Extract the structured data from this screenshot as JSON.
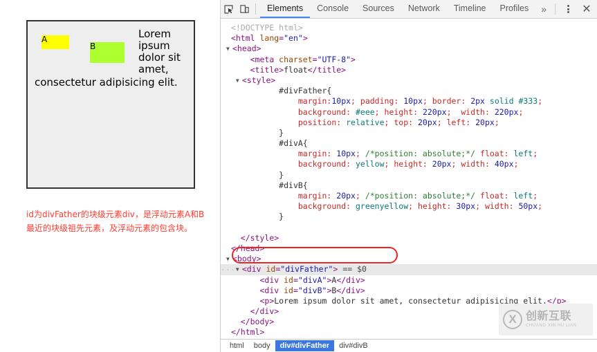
{
  "preview": {
    "box_a_label": "A",
    "box_b_label": "B",
    "paragraph": "Lorem ipsum dolor sit amet, consectetur adipisicing elit.",
    "caption": "id为divFather的块级元素div，是浮动元素A和B最近的块级祖先元素，及浮动元素的包含块。",
    "colors": {
      "father_background": "#eee",
      "father_border": "#333",
      "box_a_background": "yellow",
      "box_b_background": "greenyellow",
      "caption_color": "#ff3b30"
    }
  },
  "devtools": {
    "toolbar": {
      "inspect_icon": "inspect-element-icon",
      "device_icon": "device-toolbar-icon",
      "more_tabs_label": "»",
      "menu_icon": "kebab-menu-icon",
      "close_label": "✕"
    },
    "tabs": [
      {
        "label": "Elements",
        "active": true
      },
      {
        "label": "Console",
        "active": false
      },
      {
        "label": "Sources",
        "active": false
      },
      {
        "label": "Network",
        "active": false
      },
      {
        "label": "Timeline",
        "active": false
      },
      {
        "label": "Profiles",
        "active": false
      }
    ],
    "code_lines": [
      {
        "indent": 0,
        "tokens": [
          {
            "c": "tok-comment",
            "t": "<!DOCTYPE html>"
          }
        ]
      },
      {
        "indent": 0,
        "tokens": [
          {
            "c": "tok-punct",
            "t": "<html "
          },
          {
            "c": "tok-attr",
            "t": "lang"
          },
          {
            "c": "tok-punct",
            "t": "="
          },
          {
            "c": "tok-val",
            "t": "\"en\""
          },
          {
            "c": "tok-punct",
            "t": ">"
          }
        ]
      },
      {
        "indent": 0,
        "triangle": "▼",
        "tokens": [
          {
            "c": "tok-punct",
            "t": "<head>"
          }
        ]
      },
      {
        "indent": 2,
        "tokens": [
          {
            "c": "tok-punct",
            "t": "<meta "
          },
          {
            "c": "tok-attr",
            "t": "charset"
          },
          {
            "c": "tok-punct",
            "t": "="
          },
          {
            "c": "tok-val",
            "t": "\"UTF-8\""
          },
          {
            "c": "tok-punct",
            "t": ">"
          }
        ]
      },
      {
        "indent": 2,
        "tokens": [
          {
            "c": "tok-punct",
            "t": "<title>"
          },
          {
            "c": "tok-text",
            "t": "float"
          },
          {
            "c": "tok-punct",
            "t": "</title>"
          }
        ]
      },
      {
        "indent": 1,
        "triangle": "▼",
        "tokens": [
          {
            "c": "tok-punct",
            "t": "<style>"
          }
        ]
      },
      {
        "indent": 5,
        "tokens": [
          {
            "c": "tok-sel",
            "t": "#divFather{"
          }
        ]
      },
      {
        "indent": 7,
        "tokens": [
          {
            "c": "tok-prop",
            "t": "margin"
          },
          {
            "c": "tok-prop",
            "t": ":"
          },
          {
            "c": "tok-num",
            "t": "10px"
          },
          {
            "c": "tok-prop",
            "t": "; "
          },
          {
            "c": "tok-prop",
            "t": "padding"
          },
          {
            "c": "tok-prop",
            "t": ": "
          },
          {
            "c": "tok-num",
            "t": "10px"
          },
          {
            "c": "tok-prop",
            "t": "; "
          },
          {
            "c": "tok-prop",
            "t": "border"
          },
          {
            "c": "tok-prop",
            "t": ": "
          },
          {
            "c": "tok-num",
            "t": "2px"
          },
          {
            "c": "tok-prop",
            "t": " "
          },
          {
            "c": "tok-kw",
            "t": "solid"
          },
          {
            "c": "tok-prop",
            "t": " "
          },
          {
            "c": "tok-kw",
            "t": "#333"
          },
          {
            "c": "tok-prop",
            "t": ";"
          }
        ]
      },
      {
        "indent": 7,
        "tokens": [
          {
            "c": "tok-prop",
            "t": "background"
          },
          {
            "c": "tok-prop",
            "t": ": "
          },
          {
            "c": "tok-kw",
            "t": "#eee"
          },
          {
            "c": "tok-prop",
            "t": "; "
          },
          {
            "c": "tok-prop",
            "t": "height"
          },
          {
            "c": "tok-prop",
            "t": ": "
          },
          {
            "c": "tok-num",
            "t": "220px"
          },
          {
            "c": "tok-prop",
            "t": ";  "
          },
          {
            "c": "tok-prop",
            "t": "width"
          },
          {
            "c": "tok-prop",
            "t": ": "
          },
          {
            "c": "tok-num",
            "t": "220px"
          },
          {
            "c": "tok-prop",
            "t": ";"
          }
        ]
      },
      {
        "indent": 7,
        "tokens": [
          {
            "c": "tok-prop",
            "t": "position"
          },
          {
            "c": "tok-prop",
            "t": ": "
          },
          {
            "c": "tok-kw",
            "t": "relative"
          },
          {
            "c": "tok-prop",
            "t": "; "
          },
          {
            "c": "tok-prop",
            "t": "top"
          },
          {
            "c": "tok-prop",
            "t": ": "
          },
          {
            "c": "tok-num",
            "t": "20px"
          },
          {
            "c": "tok-prop",
            "t": "; "
          },
          {
            "c": "tok-prop",
            "t": "left"
          },
          {
            "c": "tok-prop",
            "t": ": "
          },
          {
            "c": "tok-num",
            "t": "20px"
          },
          {
            "c": "tok-prop",
            "t": ";"
          }
        ]
      },
      {
        "indent": 5,
        "tokens": [
          {
            "c": "tok-sel",
            "t": "}"
          }
        ]
      },
      {
        "indent": 5,
        "tokens": [
          {
            "c": "tok-sel",
            "t": "#divA{"
          }
        ]
      },
      {
        "indent": 7,
        "tokens": [
          {
            "c": "tok-prop",
            "t": "margin"
          },
          {
            "c": "tok-prop",
            "t": ": "
          },
          {
            "c": "tok-num",
            "t": "10px"
          },
          {
            "c": "tok-prop",
            "t": "; "
          },
          {
            "c": "tok-cmt2",
            "t": "/*position: absolute;*/"
          },
          {
            "c": "tok-prop",
            "t": " "
          },
          {
            "c": "tok-prop",
            "t": "float"
          },
          {
            "c": "tok-prop",
            "t": ": "
          },
          {
            "c": "tok-kw",
            "t": "left"
          },
          {
            "c": "tok-prop",
            "t": ";"
          }
        ]
      },
      {
        "indent": 7,
        "tokens": [
          {
            "c": "tok-prop",
            "t": "background"
          },
          {
            "c": "tok-prop",
            "t": ": "
          },
          {
            "c": "tok-kw",
            "t": "yellow"
          },
          {
            "c": "tok-prop",
            "t": "; "
          },
          {
            "c": "tok-prop",
            "t": "height"
          },
          {
            "c": "tok-prop",
            "t": ": "
          },
          {
            "c": "tok-num",
            "t": "20px"
          },
          {
            "c": "tok-prop",
            "t": "; "
          },
          {
            "c": "tok-prop",
            "t": "width"
          },
          {
            "c": "tok-prop",
            "t": ": "
          },
          {
            "c": "tok-num",
            "t": "40px"
          },
          {
            "c": "tok-prop",
            "t": ";"
          }
        ]
      },
      {
        "indent": 5,
        "tokens": [
          {
            "c": "tok-sel",
            "t": "}"
          }
        ]
      },
      {
        "indent": 5,
        "tokens": [
          {
            "c": "tok-sel",
            "t": "#divB{"
          }
        ]
      },
      {
        "indent": 7,
        "tokens": [
          {
            "c": "tok-prop",
            "t": "margin"
          },
          {
            "c": "tok-prop",
            "t": ": "
          },
          {
            "c": "tok-num",
            "t": "20px"
          },
          {
            "c": "tok-prop",
            "t": "; "
          },
          {
            "c": "tok-cmt2",
            "t": "/*position: absolute;*/"
          },
          {
            "c": "tok-prop",
            "t": " "
          },
          {
            "c": "tok-prop",
            "t": "float"
          },
          {
            "c": "tok-prop",
            "t": ": "
          },
          {
            "c": "tok-kw",
            "t": "left"
          },
          {
            "c": "tok-prop",
            "t": ";"
          }
        ]
      },
      {
        "indent": 7,
        "tokens": [
          {
            "c": "tok-prop",
            "t": "background"
          },
          {
            "c": "tok-prop",
            "t": ": "
          },
          {
            "c": "tok-kw",
            "t": "greenyellow"
          },
          {
            "c": "tok-prop",
            "t": "; "
          },
          {
            "c": "tok-prop",
            "t": "height"
          },
          {
            "c": "tok-prop",
            "t": ": "
          },
          {
            "c": "tok-num",
            "t": "30px"
          },
          {
            "c": "tok-prop",
            "t": "; "
          },
          {
            "c": "tok-prop",
            "t": "width"
          },
          {
            "c": "tok-prop",
            "t": ": "
          },
          {
            "c": "tok-num",
            "t": "50px"
          },
          {
            "c": "tok-prop",
            "t": ";"
          }
        ]
      },
      {
        "indent": 5,
        "tokens": [
          {
            "c": "tok-sel",
            "t": "}"
          }
        ]
      },
      {
        "indent": 0,
        "tokens": [
          {
            "c": "tok-sel",
            "t": " "
          }
        ]
      },
      {
        "indent": 1,
        "tokens": [
          {
            "c": "tok-punct",
            "t": "</style>"
          }
        ]
      },
      {
        "indent": 0,
        "tokens": [
          {
            "c": "tok-punct",
            "t": "</head>"
          }
        ]
      },
      {
        "indent": 0,
        "triangle": "▼",
        "tokens": [
          {
            "c": "tok-punct",
            "t": "<body>"
          }
        ]
      },
      {
        "indent": 1,
        "triangle": "▼",
        "selected": true,
        "gutter": "···",
        "tokens": [
          {
            "c": "tok-punct",
            "t": "<div "
          },
          {
            "c": "tok-attr",
            "t": "id"
          },
          {
            "c": "tok-punct",
            "t": "="
          },
          {
            "c": "tok-val",
            "t": "\"divFather\""
          },
          {
            "c": "tok-punct",
            "t": ">"
          },
          {
            "c": "tok-dollar",
            "t": " == $0"
          }
        ]
      },
      {
        "indent": 3,
        "tokens": [
          {
            "c": "tok-punct",
            "t": "<div "
          },
          {
            "c": "tok-attr",
            "t": "id"
          },
          {
            "c": "tok-punct",
            "t": "="
          },
          {
            "c": "tok-val",
            "t": "\"divA\""
          },
          {
            "c": "tok-punct",
            "t": ">"
          },
          {
            "c": "tok-text",
            "t": "A"
          },
          {
            "c": "tok-punct",
            "t": "</div>"
          }
        ]
      },
      {
        "indent": 3,
        "tokens": [
          {
            "c": "tok-punct",
            "t": "<div "
          },
          {
            "c": "tok-attr",
            "t": "id"
          },
          {
            "c": "tok-punct",
            "t": "="
          },
          {
            "c": "tok-val",
            "t": "\"divB\""
          },
          {
            "c": "tok-punct",
            "t": ">"
          },
          {
            "c": "tok-text",
            "t": "B"
          },
          {
            "c": "tok-punct",
            "t": "</div>"
          }
        ]
      },
      {
        "indent": 3,
        "tokens": [
          {
            "c": "tok-punct",
            "t": "<p>"
          },
          {
            "c": "tok-text",
            "t": "Lorem ipsum dolor sit amet, consectetur adipisicing elit."
          },
          {
            "c": "tok-punct",
            "t": "</p>"
          }
        ]
      },
      {
        "indent": 2,
        "tokens": [
          {
            "c": "tok-punct",
            "t": "</div>"
          }
        ]
      },
      {
        "indent": 1,
        "tokens": [
          {
            "c": "tok-punct",
            "t": "</body>"
          }
        ]
      },
      {
        "indent": 0,
        "tokens": [
          {
            "c": "tok-punct",
            "t": "</html>"
          }
        ]
      }
    ],
    "breadcrumb": [
      {
        "label": "html",
        "active": false
      },
      {
        "label": "body",
        "active": false
      },
      {
        "label": "div#divFather",
        "active": true
      },
      {
        "label": "div#divB",
        "active": false
      }
    ],
    "colors": {
      "active_tab_underline": "#4285f4",
      "breadcrumb_active_bg": "#3a77e0",
      "annotation_border": "#ee2222",
      "selected_row_bg": "#e8e8e8"
    }
  },
  "watermark": {
    "cn": "创新互联",
    "en": "CHUANG XIN HU LIAN",
    "mark": "X"
  }
}
